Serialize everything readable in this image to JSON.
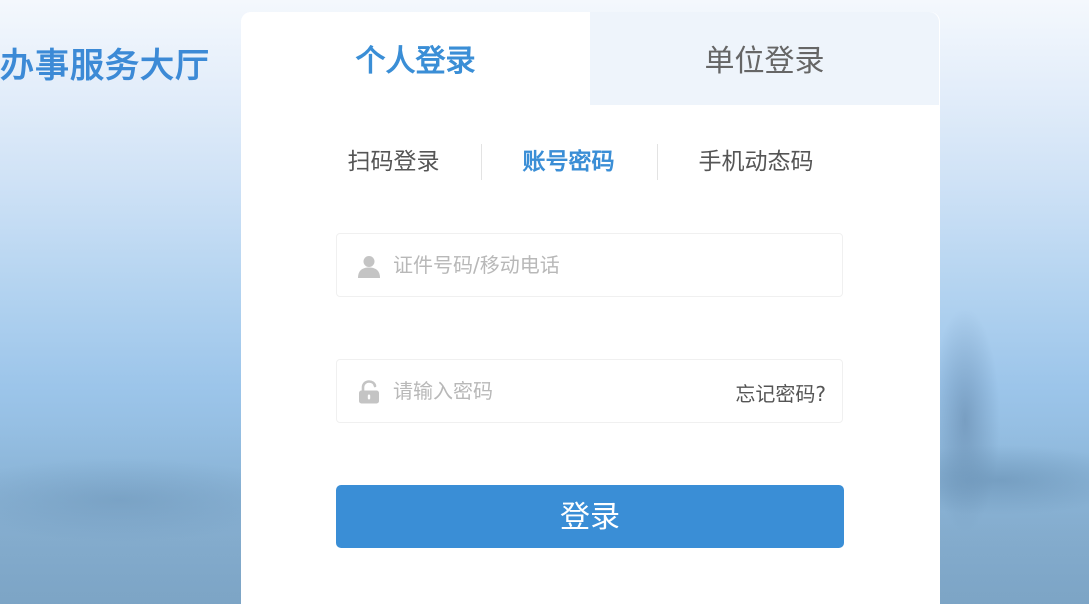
{
  "site": {
    "title": "办事服务大厅"
  },
  "login_tabs": [
    {
      "label": "个人登录",
      "active": true
    },
    {
      "label": "单位登录",
      "active": false
    }
  ],
  "login_methods": [
    {
      "label": "扫码登录",
      "active": false
    },
    {
      "label": "账号密码",
      "active": true
    },
    {
      "label": "手机动态码",
      "active": false
    }
  ],
  "form": {
    "username": {
      "placeholder": "证件号码/移动电话",
      "value": "",
      "icon": "user-icon"
    },
    "password": {
      "placeholder": "请输入密码",
      "value": "",
      "icon": "lock-icon"
    },
    "forgot_label": "忘记密码?",
    "submit_label": "登录"
  },
  "colors": {
    "accent": "#3a8ed6",
    "title": "#3c8ad6",
    "inactive_tab_bg": "#eef4fb"
  }
}
